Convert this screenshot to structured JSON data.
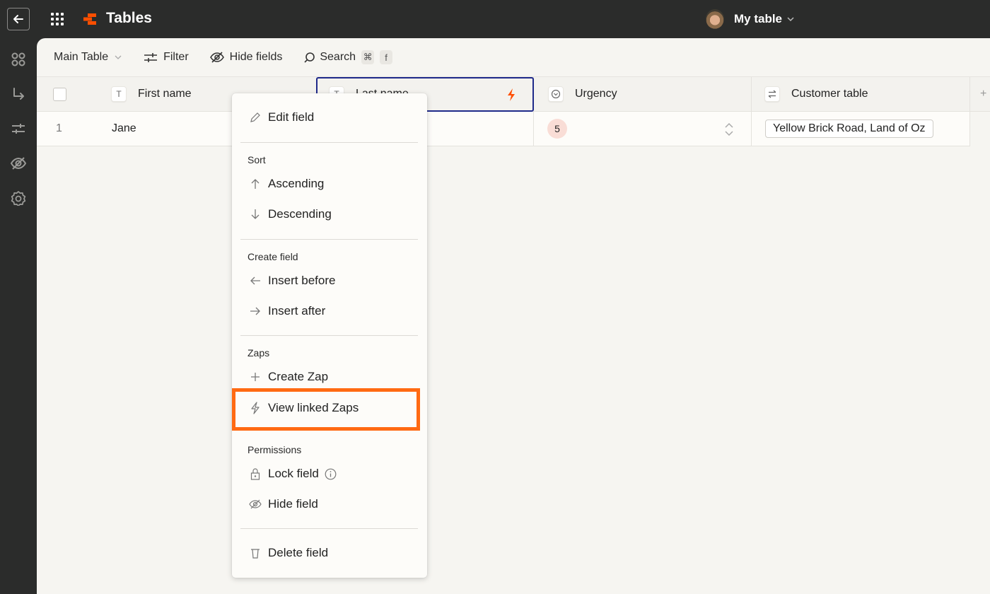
{
  "app": {
    "title": "Tables",
    "table_name": "My table",
    "brand_color": "#ff4f00"
  },
  "sidebar": {
    "items": [
      {
        "icon": "apps-nodes-icon"
      },
      {
        "icon": "redirect-arrow-icon"
      },
      {
        "icon": "filter-sliders-icon"
      },
      {
        "icon": "eye-slash-icon"
      },
      {
        "icon": "gear-icon"
      }
    ]
  },
  "toolbar": {
    "view_label": "Main Table",
    "filter_label": "Filter",
    "hide_fields_label": "Hide fields",
    "search_label": "Search",
    "search_shortcut_mod": "⌘",
    "search_shortcut_key": "f"
  },
  "table": {
    "columns": [
      {
        "type_icon": "T",
        "label": "First name"
      },
      {
        "type_icon": "T",
        "label": "Last name"
      },
      {
        "type_icon": "⌄",
        "label": "Urgency"
      },
      {
        "type_icon": "⇄",
        "label": "Customer table"
      }
    ],
    "rows": [
      {
        "index": "1",
        "first_name": "Jane",
        "last_name": "",
        "urgency": "5",
        "customer_table": "Yellow Brick Road, Land of Oz"
      }
    ],
    "add_column": "+"
  },
  "context_menu": {
    "edit_field": "Edit field",
    "sort_title": "Sort",
    "ascending": "Ascending",
    "descending": "Descending",
    "create_field_title": "Create field",
    "insert_before": "Insert before",
    "insert_after": "Insert after",
    "zaps_title": "Zaps",
    "create_zap": "Create Zap",
    "view_linked_zaps": "View linked Zaps",
    "permissions_title": "Permissions",
    "lock_field": "Lock field",
    "hide_field": "Hide field",
    "delete_field": "Delete field",
    "highlight_color": "#ff6a13"
  }
}
